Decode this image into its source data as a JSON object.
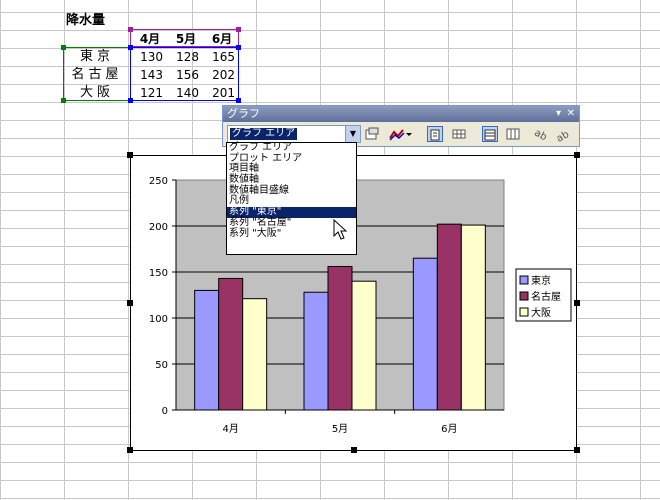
{
  "sheet": {
    "title": "降水量",
    "months": [
      "4月",
      "5月",
      "6月"
    ],
    "rows": [
      {
        "city": "東京",
        "values": [
          130,
          128,
          165
        ]
      },
      {
        "city": "名古屋",
        "values": [
          143,
          156,
          202
        ]
      },
      {
        "city": "大阪",
        "values": [
          121,
          140,
          201
        ]
      }
    ]
  },
  "toolbar": {
    "title": "グラフ",
    "combo_value": "グラフ エリア",
    "close_glyph": "✕",
    "menu_glyph": "▾"
  },
  "dropdown": {
    "items": [
      "グラフ エリア",
      "プロット エリア",
      "項目軸",
      "数値軸",
      "数値軸目盛線",
      "凡例",
      "系列 \"東京\"",
      "系列 \"名古屋\"",
      "系列 \"大阪\""
    ],
    "selected_index": 6
  },
  "colors": {
    "tokyo": "#9999ff",
    "nagoya": "#993366",
    "osaka": "#ffffcc",
    "plot_bg": "#c0c0c0"
  },
  "chart_data": {
    "type": "bar",
    "categories": [
      "4月",
      "5月",
      "6月"
    ],
    "series": [
      {
        "name": "東京",
        "values": [
          130,
          128,
          165
        ]
      },
      {
        "name": "名古屋",
        "values": [
          143,
          156,
          202
        ]
      },
      {
        "name": "大阪",
        "values": [
          121,
          140,
          201
        ]
      }
    ],
    "yticks": [
      0,
      50,
      100,
      150,
      200,
      250
    ],
    "ylim": [
      0,
      250
    ],
    "grid": true,
    "legend": "right"
  }
}
